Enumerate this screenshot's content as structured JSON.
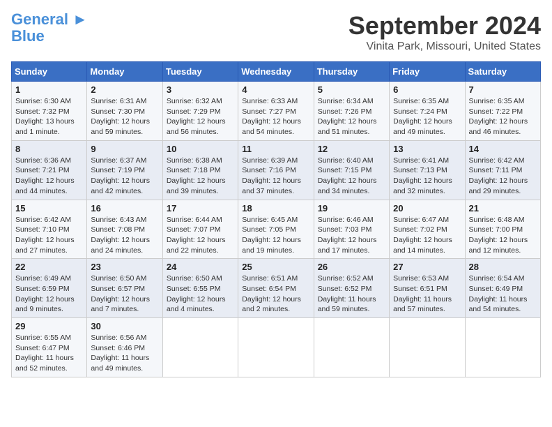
{
  "header": {
    "logo_line1": "General",
    "logo_line2": "Blue",
    "title": "September 2024",
    "subtitle": "Vinita Park, Missouri, United States"
  },
  "days_of_week": [
    "Sunday",
    "Monday",
    "Tuesday",
    "Wednesday",
    "Thursday",
    "Friday",
    "Saturday"
  ],
  "weeks": [
    [
      {
        "day": 1,
        "info": "Sunrise: 6:30 AM\nSunset: 7:32 PM\nDaylight: 13 hours\nand 1 minute."
      },
      {
        "day": 2,
        "info": "Sunrise: 6:31 AM\nSunset: 7:30 PM\nDaylight: 12 hours\nand 59 minutes."
      },
      {
        "day": 3,
        "info": "Sunrise: 6:32 AM\nSunset: 7:29 PM\nDaylight: 12 hours\nand 56 minutes."
      },
      {
        "day": 4,
        "info": "Sunrise: 6:33 AM\nSunset: 7:27 PM\nDaylight: 12 hours\nand 54 minutes."
      },
      {
        "day": 5,
        "info": "Sunrise: 6:34 AM\nSunset: 7:26 PM\nDaylight: 12 hours\nand 51 minutes."
      },
      {
        "day": 6,
        "info": "Sunrise: 6:35 AM\nSunset: 7:24 PM\nDaylight: 12 hours\nand 49 minutes."
      },
      {
        "day": 7,
        "info": "Sunrise: 6:35 AM\nSunset: 7:22 PM\nDaylight: 12 hours\nand 46 minutes."
      }
    ],
    [
      {
        "day": 8,
        "info": "Sunrise: 6:36 AM\nSunset: 7:21 PM\nDaylight: 12 hours\nand 44 minutes."
      },
      {
        "day": 9,
        "info": "Sunrise: 6:37 AM\nSunset: 7:19 PM\nDaylight: 12 hours\nand 42 minutes."
      },
      {
        "day": 10,
        "info": "Sunrise: 6:38 AM\nSunset: 7:18 PM\nDaylight: 12 hours\nand 39 minutes."
      },
      {
        "day": 11,
        "info": "Sunrise: 6:39 AM\nSunset: 7:16 PM\nDaylight: 12 hours\nand 37 minutes."
      },
      {
        "day": 12,
        "info": "Sunrise: 6:40 AM\nSunset: 7:15 PM\nDaylight: 12 hours\nand 34 minutes."
      },
      {
        "day": 13,
        "info": "Sunrise: 6:41 AM\nSunset: 7:13 PM\nDaylight: 12 hours\nand 32 minutes."
      },
      {
        "day": 14,
        "info": "Sunrise: 6:42 AM\nSunset: 7:11 PM\nDaylight: 12 hours\nand 29 minutes."
      }
    ],
    [
      {
        "day": 15,
        "info": "Sunrise: 6:42 AM\nSunset: 7:10 PM\nDaylight: 12 hours\nand 27 minutes."
      },
      {
        "day": 16,
        "info": "Sunrise: 6:43 AM\nSunset: 7:08 PM\nDaylight: 12 hours\nand 24 minutes."
      },
      {
        "day": 17,
        "info": "Sunrise: 6:44 AM\nSunset: 7:07 PM\nDaylight: 12 hours\nand 22 minutes."
      },
      {
        "day": 18,
        "info": "Sunrise: 6:45 AM\nSunset: 7:05 PM\nDaylight: 12 hours\nand 19 minutes."
      },
      {
        "day": 19,
        "info": "Sunrise: 6:46 AM\nSunset: 7:03 PM\nDaylight: 12 hours\nand 17 minutes."
      },
      {
        "day": 20,
        "info": "Sunrise: 6:47 AM\nSunset: 7:02 PM\nDaylight: 12 hours\nand 14 minutes."
      },
      {
        "day": 21,
        "info": "Sunrise: 6:48 AM\nSunset: 7:00 PM\nDaylight: 12 hours\nand 12 minutes."
      }
    ],
    [
      {
        "day": 22,
        "info": "Sunrise: 6:49 AM\nSunset: 6:59 PM\nDaylight: 12 hours\nand 9 minutes."
      },
      {
        "day": 23,
        "info": "Sunrise: 6:50 AM\nSunset: 6:57 PM\nDaylight: 12 hours\nand 7 minutes."
      },
      {
        "day": 24,
        "info": "Sunrise: 6:50 AM\nSunset: 6:55 PM\nDaylight: 12 hours\nand 4 minutes."
      },
      {
        "day": 25,
        "info": "Sunrise: 6:51 AM\nSunset: 6:54 PM\nDaylight: 12 hours\nand 2 minutes."
      },
      {
        "day": 26,
        "info": "Sunrise: 6:52 AM\nSunset: 6:52 PM\nDaylight: 11 hours\nand 59 minutes."
      },
      {
        "day": 27,
        "info": "Sunrise: 6:53 AM\nSunset: 6:51 PM\nDaylight: 11 hours\nand 57 minutes."
      },
      {
        "day": 28,
        "info": "Sunrise: 6:54 AM\nSunset: 6:49 PM\nDaylight: 11 hours\nand 54 minutes."
      }
    ],
    [
      {
        "day": 29,
        "info": "Sunrise: 6:55 AM\nSunset: 6:47 PM\nDaylight: 11 hours\nand 52 minutes."
      },
      {
        "day": 30,
        "info": "Sunrise: 6:56 AM\nSunset: 6:46 PM\nDaylight: 11 hours\nand 49 minutes."
      },
      null,
      null,
      null,
      null,
      null
    ]
  ]
}
